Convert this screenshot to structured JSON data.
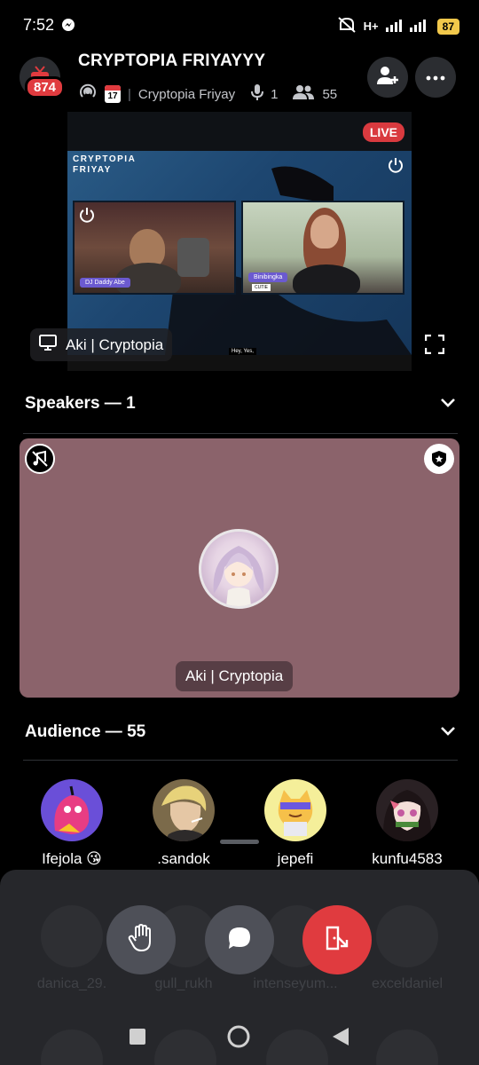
{
  "status_bar": {
    "time": "7:52",
    "network": "H+",
    "battery": "87"
  },
  "header": {
    "title": "CRYPTOPIA FRIYAYYY",
    "notification_count": "874",
    "calendar_day": "17",
    "event_name": "Cryptopia Friyay",
    "speaker_count": "1",
    "listener_count": "55"
  },
  "stream": {
    "live_label": "LIVE",
    "brand_line1": "CRYPTOPIA",
    "brand_line2": "FRIYAY",
    "cam_left_tag": "DJ Daddy Abe",
    "cam_right_tag": "Binibingka",
    "cam_right_subtag": "CUTIE",
    "caption": "Hey, Yes,",
    "streamer_label": "Aki | Cryptopia"
  },
  "speakers": {
    "heading": "Speakers — 1",
    "speaker_name": "Aki | Cryptopia"
  },
  "audience": {
    "heading": "Audience — 55",
    "members": [
      {
        "name": "Ifejola 😘"
      },
      {
        "name": ".sandok"
      },
      {
        "name": "jepefi"
      },
      {
        "name": "kunfu4583"
      }
    ],
    "faded_members": [
      {
        "name": "danica_29."
      },
      {
        "name": "gull_rukh"
      },
      {
        "name": "intenseyum..."
      },
      {
        "name": "exceldaniel"
      }
    ]
  },
  "colors": {
    "accent_red": "#e03b3f",
    "speaker_card": "#8b636b",
    "sheet_bg": "#26272b",
    "button_gray": "#4e5058"
  }
}
